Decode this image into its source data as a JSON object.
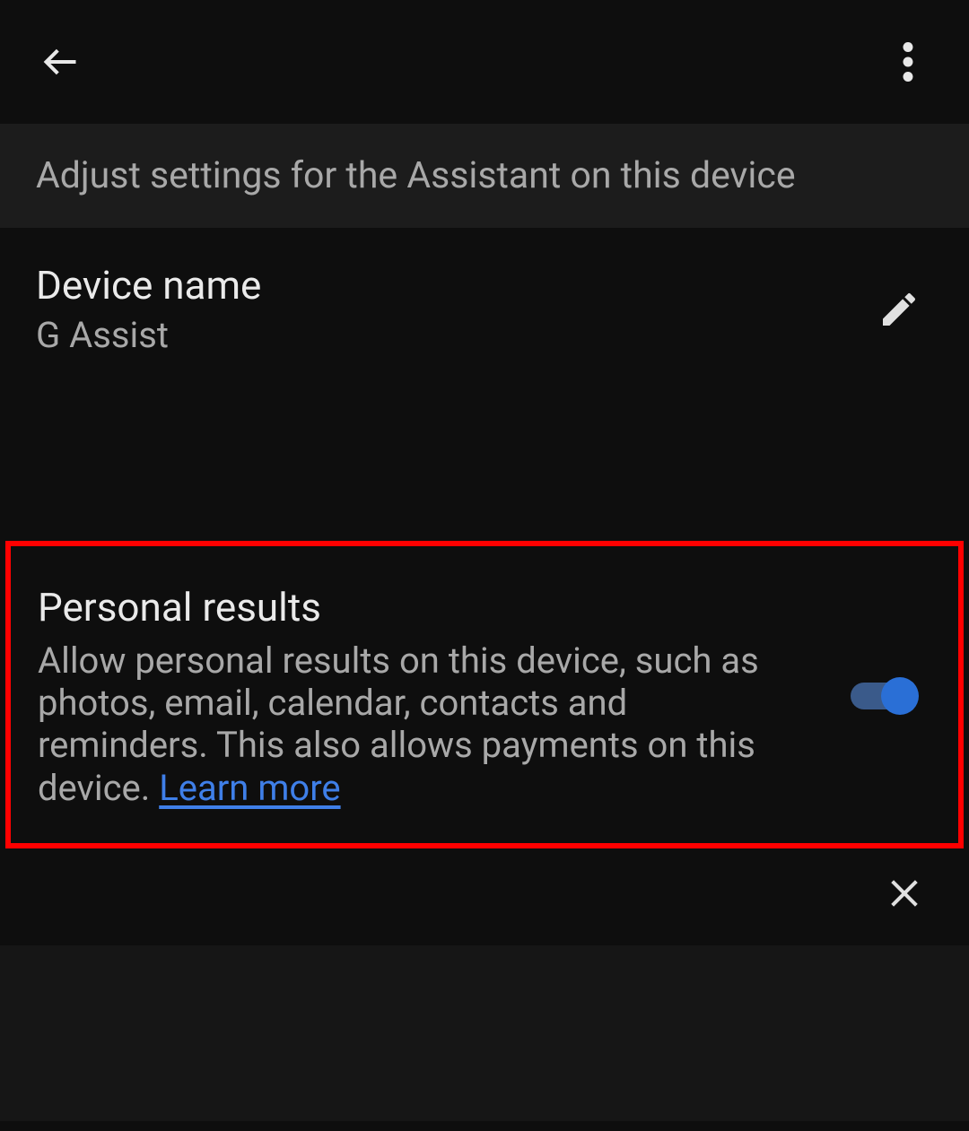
{
  "header": {
    "subtitle": "Adjust settings for the Assistant on this device"
  },
  "device_name": {
    "label": "Device name",
    "value": "G Assist"
  },
  "personal_results": {
    "title": "Personal results",
    "description": "Allow personal results on this device, such as photos, email, calendar, contacts and reminders. This also allows payments on this device. ",
    "learn_more": "Learn more",
    "enabled": true
  },
  "icons": {
    "back": "back-arrow-icon",
    "more": "more-vert-icon",
    "edit": "pencil-icon",
    "close": "close-icon"
  }
}
